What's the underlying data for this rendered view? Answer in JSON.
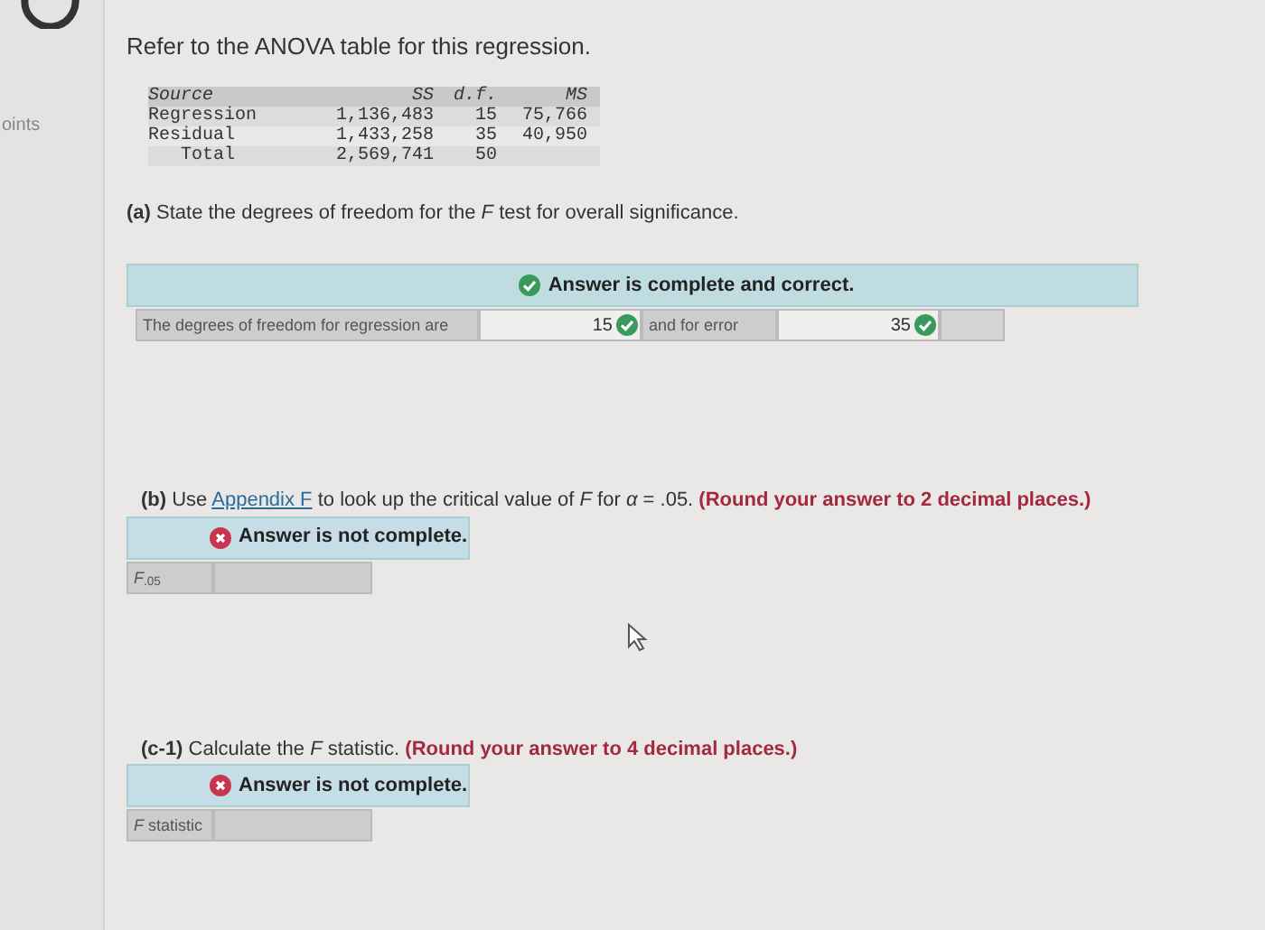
{
  "sidebar": {
    "label": "oints"
  },
  "intro": "Refer to the ANOVA table for this regression.",
  "anova": {
    "columns": [
      "Source",
      "SS",
      "d.f.",
      "MS"
    ],
    "rows": [
      [
        "Regression",
        "1,136,483",
        "15",
        "75,766"
      ],
      [
        "Residual",
        "1,433,258",
        "35",
        "40,950"
      ],
      [
        "Total",
        "2,569,741",
        "50",
        ""
      ]
    ]
  },
  "parts": [
    {
      "label": "(a)",
      "prompt": "State the degrees of freedom for the *F* test for overall significance.",
      "result": {
        "correct": true,
        "message": "Answer is complete and correct."
      },
      "cells": [
        {
          "kind": "label",
          "text": "The degrees of freedom for regression are"
        },
        {
          "kind": "input",
          "value": "15",
          "correct": true
        },
        {
          "kind": "label",
          "text": "and for error"
        },
        {
          "kind": "input",
          "value": "35",
          "correct": true
        },
        {
          "kind": "blank"
        }
      ]
    },
    {
      "label": "(b)",
      "prompt": "Use",
      "link": "Appendix F",
      "after_link": "to look up the critical value of *F* for *α* = .05.",
      "instruction": "(Round your answer to 2 decimal places.)",
      "result": {
        "correct": false,
        "message": "Answer is not complete."
      },
      "cells": [
        {
          "kind": "label",
          "text": "*F*$_{.05}$"
        },
        {
          "kind": "input"
        }
      ]
    },
    {
      "label": "(c-1)",
      "prompt": "Calculate the *F* statistic.",
      "instruction": "(Round your answer to 4 decimal places.)",
      "result": {
        "correct": false,
        "message": "Answer is not complete."
      },
      "cells": [
        {
          "kind": "label",
          "text": "*F* statistic"
        },
        {
          "kind": "input"
        }
      ]
    }
  ]
}
